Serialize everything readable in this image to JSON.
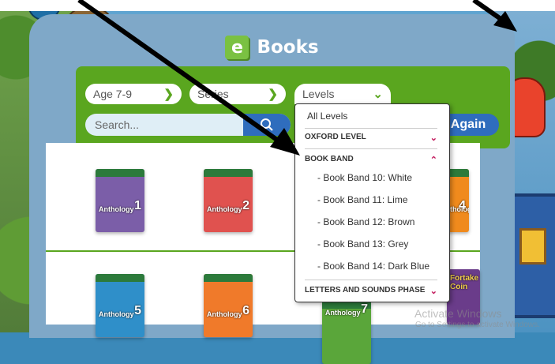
{
  "header": {
    "logo_letter": "e",
    "title": "Books"
  },
  "filters": {
    "age": {
      "label": "Age 7-9"
    },
    "series": {
      "label": "Series"
    },
    "levels": {
      "label": "Levels"
    },
    "search": {
      "placeholder": "Search..."
    },
    "search_again_label": "Again"
  },
  "levels_dropdown": {
    "all_levels": "All Levels",
    "oxford_level": "OXFORD LEVEL",
    "book_band": "BOOK BAND",
    "book_band_items": [
      "- Book Band 10: White",
      "- Book Band 11: Lime",
      "- Book Band 12: Brown",
      "- Book Band 13: Grey",
      "- Book Band 14: Dark Blue"
    ],
    "letters_and_sounds": "LETTERS AND SOUNDS PHASE"
  },
  "books": [
    {
      "title": "Anthology",
      "number": "1",
      "color": "#7b5ea8"
    },
    {
      "title": "Anthology",
      "number": "2",
      "color": "#e0524f"
    },
    {
      "title": "Anthology",
      "number": "4",
      "color": "#f08a1d"
    },
    {
      "title": "Anthology",
      "number": "5",
      "color": "#2f8fc9"
    },
    {
      "title": "Anthology",
      "number": "6",
      "color": "#f07a2a"
    },
    {
      "title": "Anthology",
      "number": "7",
      "color": "#5aa63a"
    },
    {
      "title": "Fortake Coin",
      "number": "",
      "color": "#6a3c8a"
    }
  ],
  "watermark": {
    "line1": "Activate Windows",
    "line2": "Go to Settings to activate Windows."
  },
  "colors": {
    "filterbar": "#5aa61f",
    "accent_blue": "#2f6dbd",
    "dropdown_chevron": "#c2185b"
  }
}
